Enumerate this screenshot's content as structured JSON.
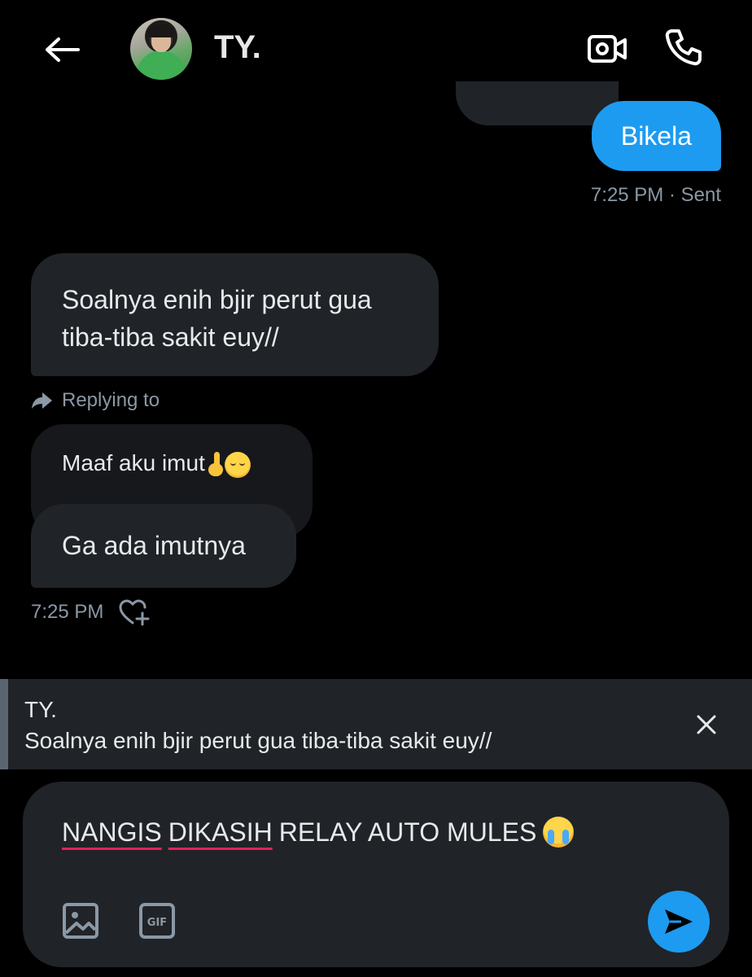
{
  "header": {
    "title": "TY.",
    "icons": {
      "back": "arrow-left-icon",
      "video": "video-camera-icon",
      "call": "phone-icon"
    }
  },
  "messages": {
    "sent": {
      "text": "Bikela",
      "meta": "7:25 PM · Sent"
    },
    "received_1": {
      "line1": "Soalnya enih bjir perut gua",
      "line2": "tiba-tiba sakit euy//"
    },
    "reply_label": "Replying to",
    "quoted": {
      "text": "Maaf aku imut"
    },
    "received_2": {
      "text": "Ga ada imutnya"
    },
    "received_meta": "7:25 PM"
  },
  "reply_preview": {
    "name": "TY.",
    "text": "Soalnya enih bjir perut gua tiba-tiba sakit euy//"
  },
  "composer": {
    "word1": "NANGIS",
    "word2": "DIKASIH",
    "rest": "RELAY AUTO MULES",
    "icons": {
      "image": "image-icon",
      "gif": "gif-icon",
      "send": "send-icon"
    }
  },
  "colors": {
    "background": "#000000",
    "accent": "#1d9bf0",
    "bubble_received": "#202327",
    "muted_text": "#8b98a5",
    "spellcheck_underline": "#e0245e"
  }
}
